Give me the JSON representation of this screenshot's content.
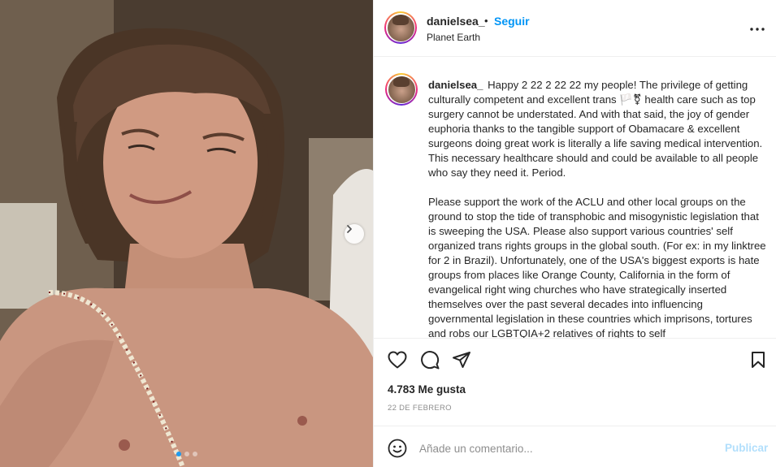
{
  "post": {
    "username": "danielsea_",
    "follow_label": "Seguir",
    "separator": "•",
    "location": "Planet Earth",
    "caption_paragraphs": [
      "Happy 2 22 2 22 22 my people! The privilege of getting culturally competent and excellent trans 🏳️⚧ health care such as top surgery cannot be understated. And with that said, the joy of gender euphoria thanks to the tangible support of Obamacare & excellent surgeons doing great work is literally a life saving medical intervention. This necessary healthcare should and could be available to all people who say they need it. Period.",
      "Please support the work of the ACLU and other local groups on the ground to stop the tide of transphobic and misogynistic legislation that is sweeping the USA. Please also support various countries' self organized trans rights groups in the global south. (For ex: in my linktree for 2 in Brazil). Unfortunately, one of the USA's biggest exports is hate groups from places like Orange County, California in the form of evangelical right wing churches who have strategically inserted themselves over the past several decades into influencing governmental legislation in these countries which imprisons, tortures and robs our LGBTQIA+2 relatives of rights to self"
    ],
    "likes": "4.783 Me gusta",
    "date": "22 DE FEBRERO",
    "carousel": {
      "count": 3,
      "active_index": 0
    }
  },
  "comment": {
    "placeholder": "Añade un comentario...",
    "post_label": "Publicar"
  },
  "icons": {
    "more": "more-horizontal-icon",
    "like": "heart-icon",
    "comment": "comment-bubble-icon",
    "share": "paper-plane-icon",
    "save": "bookmark-icon",
    "emoji": "smiley-icon",
    "next": "chevron-right-icon"
  },
  "colors": {
    "link": "#0095f6",
    "post_disabled": "#b2dffc",
    "muted": "#8e8e8e",
    "text": "#262626",
    "divider": "#efefef"
  }
}
